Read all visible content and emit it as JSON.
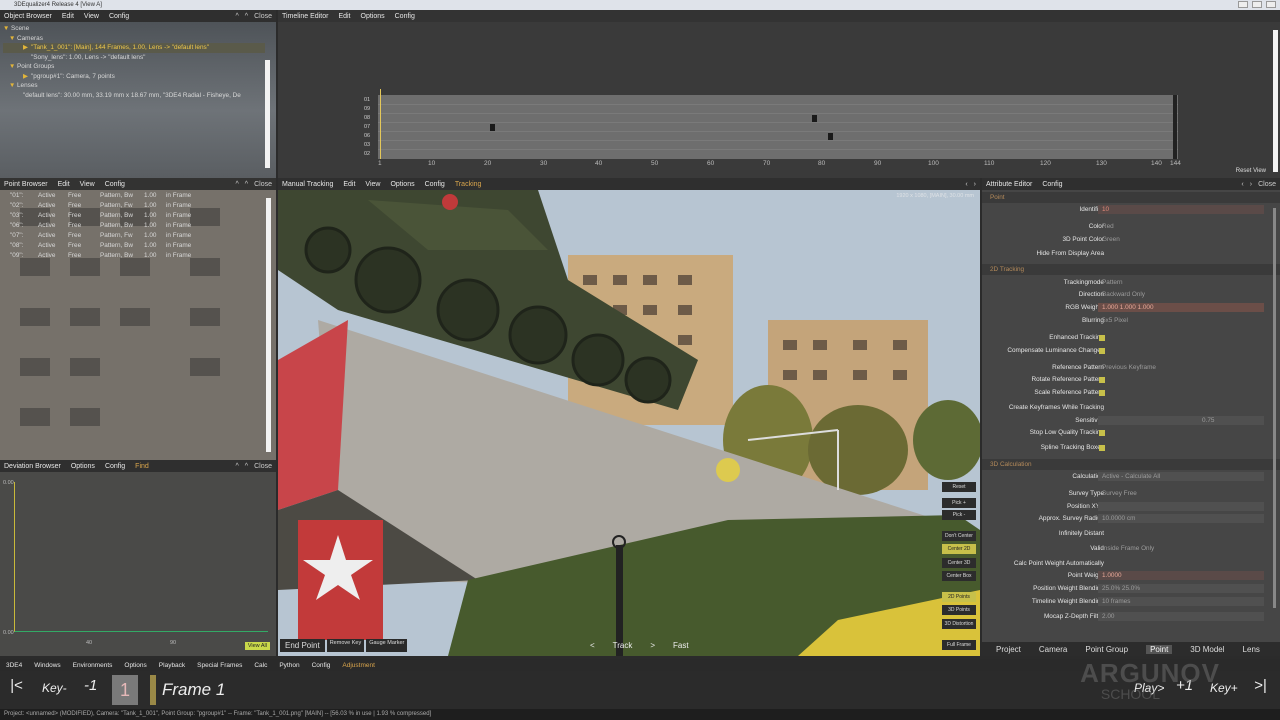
{
  "window": {
    "title": "3DEqualizer4 Release 4 [View A]"
  },
  "object_browser": {
    "menu": [
      "Object Browser",
      "Edit",
      "View",
      "Config"
    ],
    "controls": [
      "^",
      "^",
      "Close"
    ],
    "tree": [
      "Scene",
      "Cameras",
      "\"Tank_1_001\": [Main], 144 Frames, 1.00, Lens -> \"default lens\"",
      "\"Sony_lens\": 1.00, Lens -> \"default lens\"",
      "Point Groups",
      "\"pgroup#1\": Camera, 7 points",
      "Lenses",
      "\"default lens\": 30.00 mm, 33.19 mm x 18.67 mm, \"3DE4 Radial - Fisheye, De"
    ]
  },
  "timeline": {
    "menu": [
      "Timeline Editor",
      "Edit",
      "Options",
      "Config"
    ],
    "row_labels": [
      "01",
      "09",
      "08",
      "07",
      "06",
      "03",
      "02"
    ],
    "ticks": [
      "1",
      "10",
      "20",
      "30",
      "40",
      "50",
      "60",
      "70",
      "80",
      "90",
      "100",
      "110",
      "120",
      "130",
      "140",
      "144"
    ],
    "reset_view": "Reset View"
  },
  "point_browser": {
    "menu": [
      "Point Browser",
      "Edit",
      "View",
      "Config"
    ],
    "controls": [
      "^",
      "^",
      "Close"
    ],
    "rows": [
      [
        "\"01\":",
        "Active",
        "Free",
        "Pattern, Bw",
        "1.00",
        "in Frame"
      ],
      [
        "\"02\":",
        "Active",
        "Free",
        "Pattern, Fw",
        "1.00",
        "in Frame"
      ],
      [
        "\"03\":",
        "Active",
        "Free",
        "Pattern, Bw",
        "1.00",
        "in Frame"
      ],
      [
        "\"06\":",
        "Active",
        "Free",
        "Pattern, Bw",
        "1.00",
        "in Frame"
      ],
      [
        "\"07\":",
        "Active",
        "Free",
        "Pattern, Fw",
        "1.00",
        "in Frame"
      ],
      [
        "\"08\":",
        "Active",
        "Free",
        "Pattern, Bw",
        "1.00",
        "in Frame"
      ],
      [
        "\"09\":",
        "Active",
        "Free",
        "Pattern, Bw",
        "1.00",
        "in Frame"
      ]
    ]
  },
  "deviation_browser": {
    "menu": [
      "Deviation Browser",
      "Options",
      "Config",
      "Find"
    ],
    "controls": [
      "^",
      "^",
      "Close"
    ],
    "y_labels": [
      "0.00",
      "0.00"
    ],
    "x_labels": [
      "40",
      "90"
    ],
    "view_all": "View All"
  },
  "manual_tracking": {
    "menu": [
      "Manual Tracking",
      "Edit",
      "View",
      "Options",
      "Config",
      "Tracking"
    ],
    "info": "1920 x 1080, [MAIN], 30.00 mm",
    "right_buttons": [
      "Reset",
      "Pick +",
      "Pick -",
      "Don't Center",
      "Center 2D",
      "Center 3D",
      "Center Box",
      "2D Points",
      "3D Points",
      "3D Distortion",
      "Full Frame"
    ],
    "left_buttons": [
      "End Point",
      "Remove Key",
      "Gauge Marker"
    ],
    "track_controls": [
      "<",
      "Track",
      ">",
      "Fast"
    ]
  },
  "attribute_editor": {
    "menu": [
      "Attribute Editor",
      "Config"
    ],
    "sections": {
      "point": "Point",
      "tracking": "2D Tracking",
      "calculation": "3D Calculation"
    },
    "fields": {
      "identifier": {
        "label": "Identifier",
        "value": "10"
      },
      "color": {
        "label": "Color",
        "value": "Red"
      },
      "point3d_color": {
        "label": "3D Point Color",
        "value": "Green"
      },
      "hide_from_display": {
        "label": "Hide From Display Area"
      },
      "tracking_mode": {
        "label": "Trackingmode",
        "value": "Pattern"
      },
      "direction": {
        "label": "Direction",
        "value": "Backward Only"
      },
      "rgb_weights": {
        "label": "RGB Weights",
        "value": "1.000 1.000 1.000"
      },
      "blurring": {
        "label": "Blurring",
        "value": "5x5 Pixel"
      },
      "enhanced_tracking": {
        "label": "Enhanced Tracking"
      },
      "comp_lum": {
        "label": "Compensate Luminance Changes"
      },
      "ref_pattern": {
        "label": "Reference Pattern",
        "value": "Previous Keyframe"
      },
      "rotate_ref": {
        "label": "Rotate Reference Pattern"
      },
      "scale_ref": {
        "label": "Scale Reference Pattern"
      },
      "create_keyframes": {
        "label": "Create Keyframes While Tracking"
      },
      "sensitivity": {
        "label": "Sensitivity",
        "value": "0.75"
      },
      "stop_low": {
        "label": "Stop Low Quality Tracking"
      },
      "spline_boxes": {
        "label": "Spline Tracking Boxes"
      },
      "calculation": {
        "label": "Calculation",
        "value": "Active - Calculate All"
      },
      "survey_type": {
        "label": "Survey Type",
        "value": "Survey Free"
      },
      "position_xyz": {
        "label": "Position XYZ"
      },
      "approx_radius": {
        "label": "Approx. Survey Radius",
        "value": "10.0000 cm"
      },
      "infinitely_distant": {
        "label": "Infinitely Distant"
      },
      "valid": {
        "label": "Valid",
        "value": "Inside Frame Only"
      },
      "calc_point_weight": {
        "label": "Calc Point Weight Automatically"
      },
      "point_weight": {
        "label": "Point Weight",
        "value": "1.0000"
      },
      "position_weight": {
        "label": "Position Weight Blending",
        "value": "25.0%  25.0%"
      },
      "timeline_weight": {
        "label": "Timeline Weight Blending",
        "value": "10 frames"
      },
      "mocap_z": {
        "label": "Mocap Z-Depth Filter",
        "value": "2.00"
      }
    },
    "tabs": [
      "Project",
      "Camera",
      "Point Group",
      "Point",
      "3D Model",
      "Lens"
    ]
  },
  "menubar": [
    "3DE4",
    "Windows",
    "Environments",
    "Options",
    "Playback",
    "Special Frames",
    "Calc",
    "Python",
    "Config",
    "Adjustment"
  ],
  "transport": {
    "first": "|<",
    "key_prev": "Key-",
    "minus_one": "-1",
    "frame_number": "1",
    "frame_label": "Frame 1",
    "play": "Play>",
    "plus_one": "+1",
    "key_next": "Key+",
    "last": ">|"
  },
  "status": "Project: <unnamed> (MODIFIED), Camera: \"Tank_1_001\", Point Group: \"pgroup#1\" -- Frame: \"Tank_1_001.png\" [MAIN] -- [56.03 % in use | 1.93 % compressed]",
  "watermark": {
    "line1": "ARGUNOV",
    "line2": "SCHOOL"
  }
}
